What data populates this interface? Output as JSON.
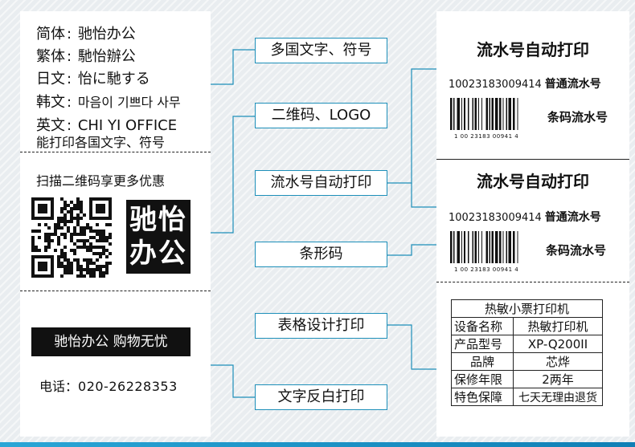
{
  "languages": [
    {
      "label": "简体",
      "value": "驰怡办公"
    },
    {
      "label": "繁体",
      "value": "馳怡辦公"
    },
    {
      "label": "日文",
      "value": "怡に馳する"
    },
    {
      "label": "韩文",
      "value": "마음이 기쁘다 사무"
    },
    {
      "label": "英文",
      "value": "CHI YI OFFICE"
    }
  ],
  "languages_caption": "能打印各国文字、符号",
  "scan_text": "扫描二维码享更多优惠",
  "brand_tile": {
    "line1": "驰怡",
    "line2": "办公"
  },
  "slogan": "驰怡办公  购物无忧",
  "phone": {
    "label": "电话：",
    "number": "020-26228353"
  },
  "features": [
    "多国文字、符号",
    "二维码、LOGO",
    "流水号自动打印",
    "条形码",
    "表格设计打印",
    "文字反白打印"
  ],
  "serial_blocks": [
    {
      "title": "流水号自动打印",
      "number": "10023183009414",
      "serial_label": "普通流水号",
      "barcode_label": "条码流水号",
      "digits": "1  00  23183  00941  4"
    },
    {
      "title": "流水号自动打印",
      "number": "10023183009414",
      "serial_label": "普通流水号",
      "barcode_label": "条码流水号",
      "digits": "1  00  23183  00941  4"
    }
  ],
  "spec_table": {
    "title": "热敏小票打印机",
    "rows": [
      {
        "key": "设备名称",
        "value": "热敏打印机"
      },
      {
        "key": "产品型号",
        "value": "XP-Q200II"
      },
      {
        "key": "品牌",
        "value": "芯烨"
      },
      {
        "key": "保修年限",
        "value": "2两年"
      },
      {
        "key": "特色保障",
        "value": "七天无理由退货"
      }
    ]
  },
  "colors": {
    "accent": "#1d8fb9",
    "background": "#e9edf0",
    "dark": "#111111"
  }
}
